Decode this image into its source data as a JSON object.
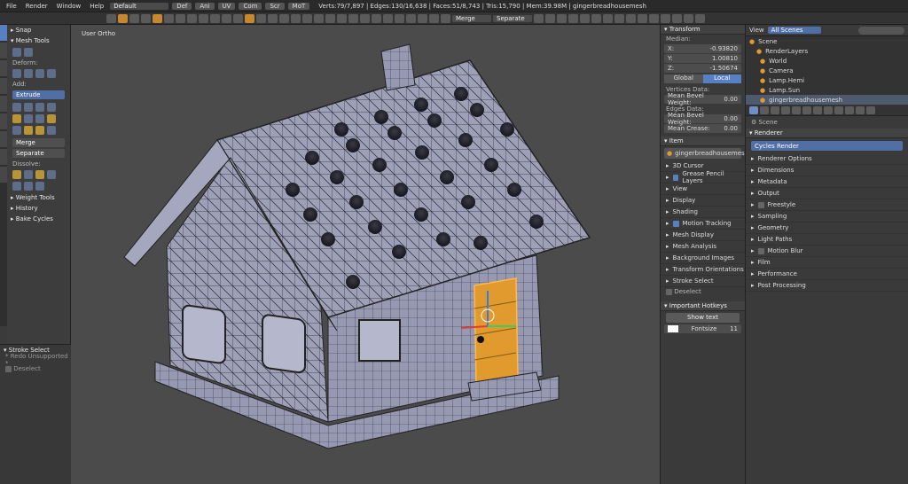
{
  "menu": [
    "File",
    "Render",
    "Window",
    "Help"
  ],
  "layout": "Default",
  "modes": [
    "Def",
    "Ani",
    "UV",
    "Com",
    "Scr",
    "MoT"
  ],
  "stats": "Verts:79/7,897 | Edges:130/16,638 | Faces:51/8,743 | Tris:15,790 | Mem:39.98M | gingerbreadhousemesh",
  "toolbar": {
    "merge": "Merge",
    "separate": "Separate"
  },
  "left_panel": {
    "snap": "Snap",
    "mesh_tools": "Mesh Tools",
    "deform": "Deform:",
    "add": "Add:",
    "extrude": "Extrude",
    "merge": "Merge",
    "separate": "Separate",
    "dissolve": "Dissolve:",
    "weight_tools": "Weight Tools",
    "history": "History",
    "bake_cycles": "Bake Cycles"
  },
  "left_bottom": {
    "stroke_select": "Stroke Select",
    "redo": "* Redo Unsupported *",
    "deselect": "Deselect"
  },
  "viewport": {
    "label": "User Ortho"
  },
  "transform": {
    "title": "Transform",
    "median": "Median:",
    "x_label": "X:",
    "x": "-0.93820",
    "y_label": "Y:",
    "y": "1.00810",
    "z_label": "Z:",
    "z": "-1.50674",
    "global": "Global",
    "local": "Local",
    "vertices_data": "Vertices Data:",
    "mean_bevel_weight_label": "Mean Bevel Weight:",
    "mean_bevel_weight": "0.00",
    "edges_data": "Edges Data:",
    "mean_bevel_weight_e_label": "Mean Bevel Weight:",
    "mean_bevel_weight_e": "0.00",
    "mean_crease_label": "Mean Crease:",
    "mean_crease": "0.00"
  },
  "item": {
    "title": "Item",
    "name": "gingerbreadhousemesh"
  },
  "props_rows": [
    {
      "label": "3D Cursor",
      "check": false
    },
    {
      "label": "Grease Pencil Layers",
      "check": true
    },
    {
      "label": "View",
      "check": false
    },
    {
      "label": "Display",
      "check": false
    },
    {
      "label": "Shading",
      "check": false
    },
    {
      "label": "Motion Tracking",
      "check": true
    },
    {
      "label": "Mesh Display",
      "check": false
    },
    {
      "label": "Mesh Analysis",
      "check": false
    },
    {
      "label": "Background Images",
      "check": false
    },
    {
      "label": "Transform Orientations",
      "check": false
    },
    {
      "label": "Stroke Select",
      "check": false
    }
  ],
  "deselect": "Deselect",
  "hotkeys": {
    "title": "Important Hotkeys",
    "show_text": "Show text",
    "fontsize_label": "Fontsize",
    "fontsize": "11"
  },
  "outliner": {
    "view": "View",
    "search_dropdown": "All Scenes",
    "rows": [
      "Scene",
      "RenderLayers",
      "World",
      "Camera",
      "Lamp.Hemi",
      "Lamp.Sun",
      "gingerbreadhousemesh"
    ]
  },
  "render": {
    "scene": "Scene",
    "renderer_header": "Renderer",
    "renderer": "Cycles Render",
    "rows": [
      "Renderer Options",
      "Dimensions",
      "Metadata",
      "Output",
      "Freestyle",
      "Sampling",
      "Geometry",
      "Light Paths",
      "Motion Blur",
      "Film",
      "Performance",
      "Post Processing"
    ]
  },
  "colors": {
    "accent": "#5680c2",
    "orange_select": "#e09a2e",
    "mesh": "#9a9cb4"
  }
}
